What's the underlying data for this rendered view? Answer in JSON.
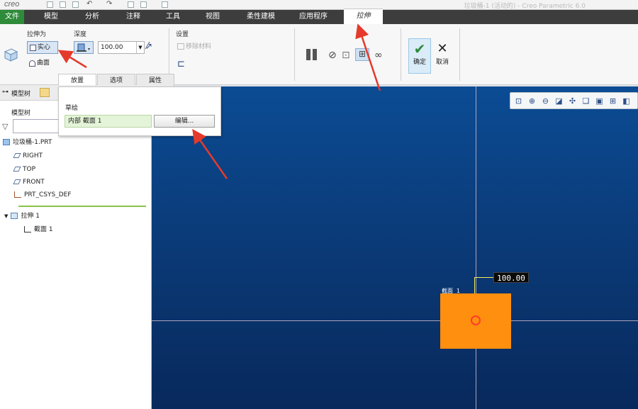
{
  "titlebar": {
    "app_logo": "creo",
    "window_title": "垃圾桶-1 (活动的) - Creo Parametric 6.0"
  },
  "menubar": {
    "file": "文件",
    "tabs": [
      "模型",
      "分析",
      "注释",
      "工具",
      "视图",
      "柔性建模",
      "应用程序"
    ],
    "active_tab": "拉伸"
  },
  "ribbon": {
    "extrude_as_label": "拉伸为",
    "solid_label": "实心",
    "surface_label": "曲面",
    "depth_label": "深度",
    "depth_value": "100.00",
    "settings_label": "设置",
    "remove_material_label": "移除材料",
    "ok_label": "确定",
    "cancel_label": "取消"
  },
  "subtabs": {
    "placement": "放置",
    "options": "选项",
    "properties": "属性"
  },
  "placement_panel": {
    "sketch_label": "草绘",
    "sketch_value": "内部 截面 1",
    "edit_button": "编辑..."
  },
  "model_tree": {
    "tab_label": "模型树",
    "header": "模型树",
    "part": "垃圾桶-1.PRT",
    "datums": [
      "RIGHT",
      "TOP",
      "FRONT",
      "PRT_CSYS_DEF"
    ],
    "feature": "拉伸 1",
    "sketch": "截面 1"
  },
  "viewport": {
    "dimension_value": "100.00",
    "section_label": "截面 1"
  },
  "colors": {
    "file_tab": "#2e8b3a",
    "viewport_top": "#0b4c94",
    "viewport_bottom": "#08295c",
    "sketch_fill": "#ff8f0e",
    "arrow": "#e53a2b"
  }
}
